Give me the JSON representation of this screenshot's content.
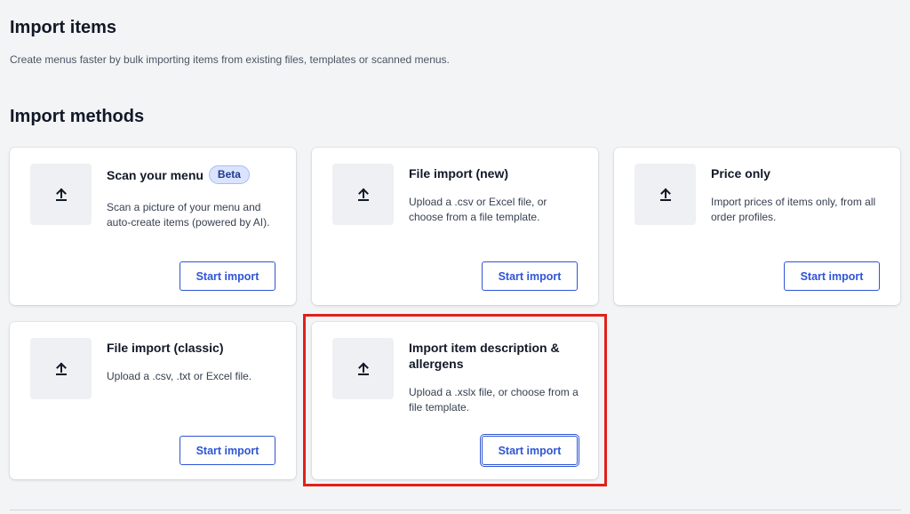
{
  "header": {
    "title": "Import items",
    "subtitle": "Create menus faster by bulk importing items from existing files, templates or scanned menus."
  },
  "section": {
    "title": "Import methods"
  },
  "icon_name": "upload-icon",
  "colors": {
    "accent": "#2f55d4",
    "highlight": "#e0201b",
    "badge_bg": "#dbe4ff"
  },
  "cards": [
    {
      "title": "Scan your menu",
      "badge": "Beta",
      "description": "Scan a picture of your menu and auto-create items (powered by AI).",
      "button": "Start import"
    },
    {
      "title": "File import (new)",
      "description": "Upload a .csv or Excel file, or choose from a file template.",
      "button": "Start import"
    },
    {
      "title": "Price only",
      "description": "Import prices of items only, from all order profiles.",
      "button": "Start import"
    },
    {
      "title": "File import (classic)",
      "description": "Upload a .csv, .txt or Excel file.",
      "button": "Start import"
    },
    {
      "title": "Import item description & allergens",
      "description": "Upload a .xslx file, or choose from a file template.",
      "button": "Start import"
    }
  ]
}
